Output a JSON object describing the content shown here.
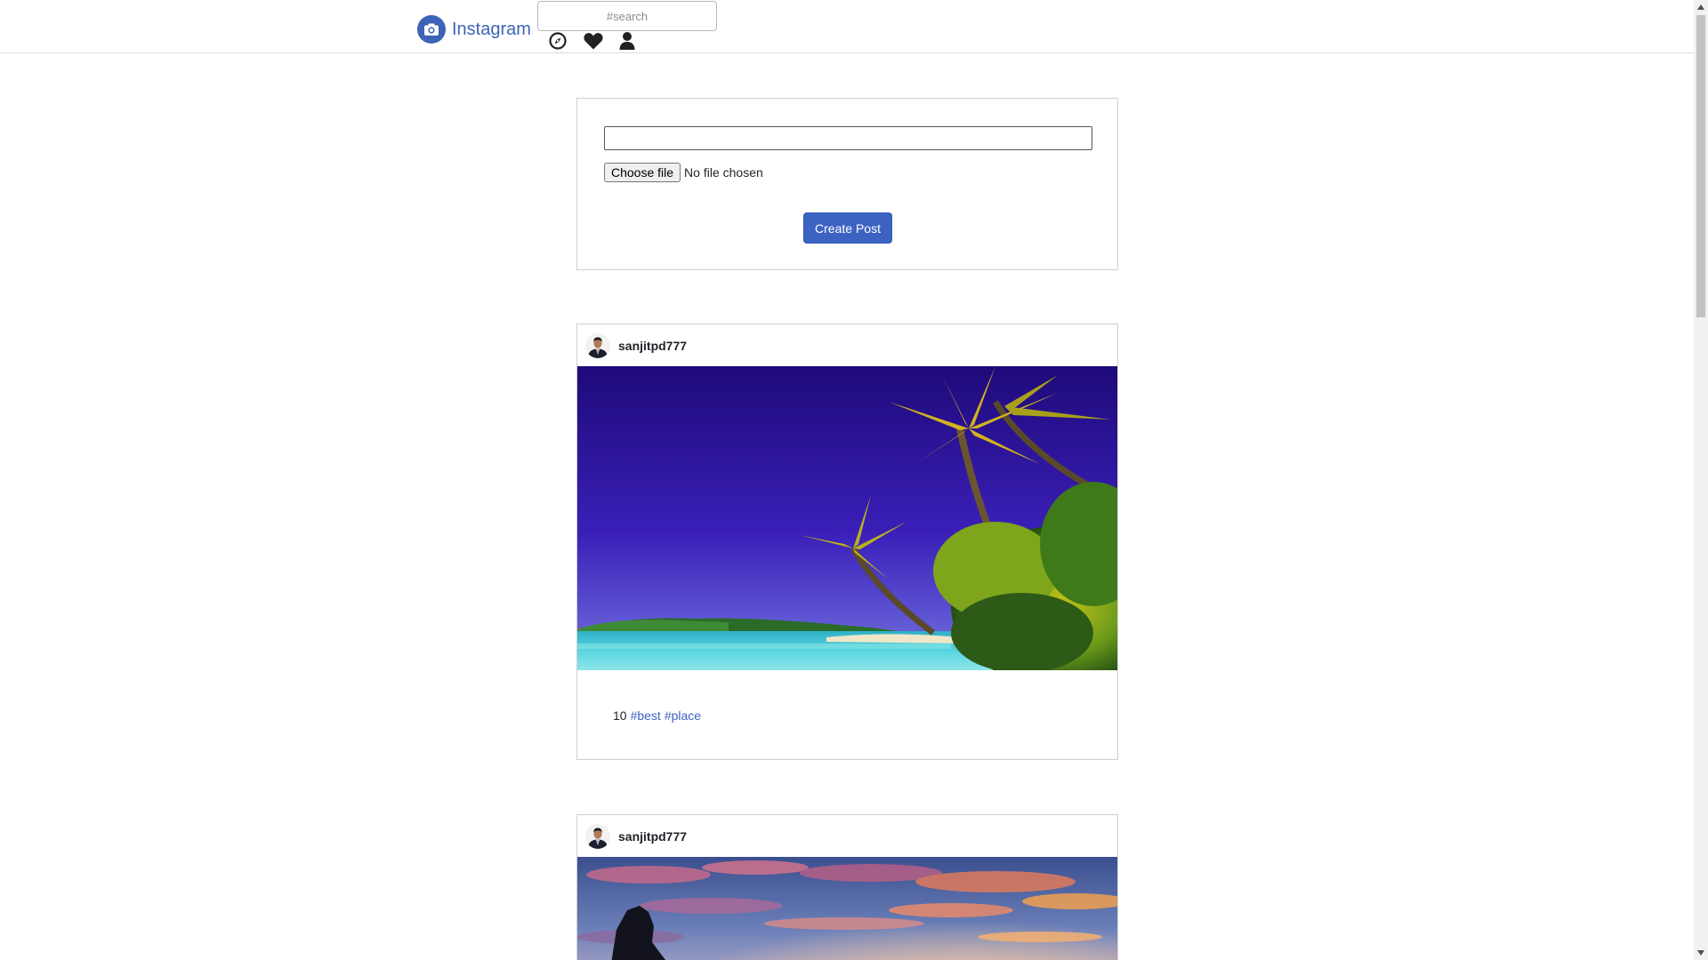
{
  "app": {
    "brand": "Instagram",
    "accent_color": "#3c63b6"
  },
  "navbar": {
    "search_placeholder": "#search",
    "icons": [
      "explore-icon",
      "heart-icon",
      "profile-icon"
    ]
  },
  "create_post": {
    "caption_value": "",
    "file_button_label": "Choose file",
    "file_status": "No file chosen",
    "submit_label": "Create Post"
  },
  "posts": [
    {
      "username": "sanjitpd777",
      "image": "tropical-beach-palms",
      "likes": "10",
      "hashtags": [
        "#best",
        "#place"
      ]
    },
    {
      "username": "sanjitpd777",
      "image": "sunset-sky-rock"
    }
  ]
}
